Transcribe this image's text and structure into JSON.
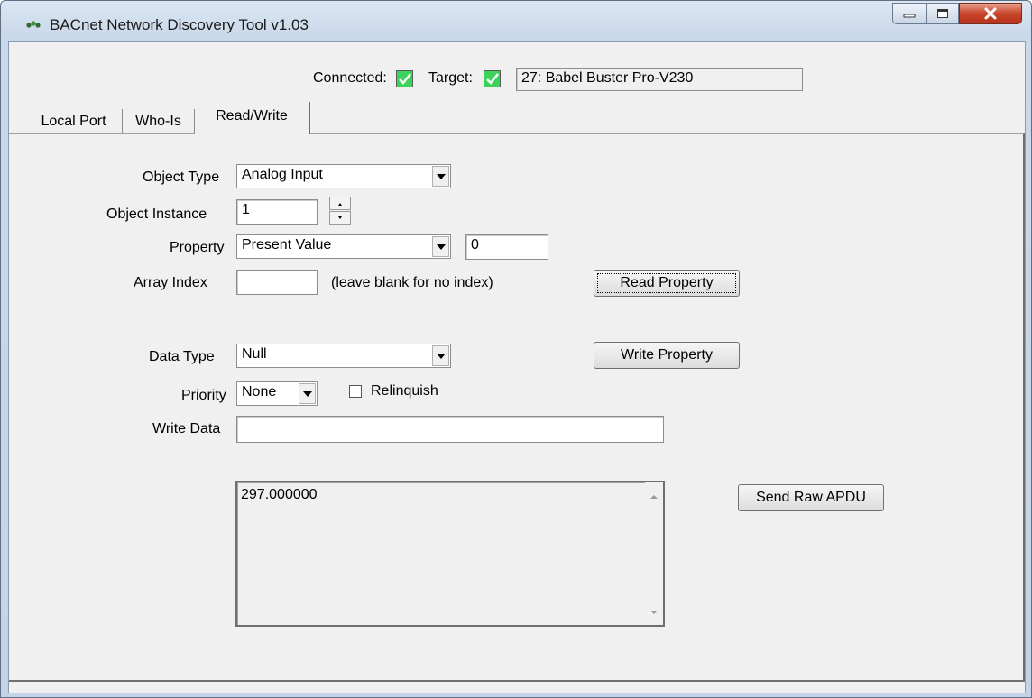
{
  "window": {
    "title": "BACnet Network Discovery Tool v1.03",
    "controls": {
      "minimize": "minimize",
      "maximize": "maximize",
      "close": "close"
    }
  },
  "status": {
    "connected_label": "Connected:",
    "connected_checked": true,
    "target_label": "Target:",
    "target_checked": true,
    "target_value": "27: Babel Buster Pro-V230"
  },
  "tabs": [
    {
      "label": "Local Port",
      "active": false
    },
    {
      "label": "Who-Is",
      "active": false
    },
    {
      "label": "Read/Write",
      "active": true
    }
  ],
  "read_write": {
    "object_type_label": "Object Type",
    "object_type_value": "Analog Input",
    "object_instance_label": "Object Instance",
    "object_instance_value": "1",
    "property_label": "Property",
    "property_value": "Present Value",
    "property_id_value": "0",
    "array_index_label": "Array Index",
    "array_index_value": "",
    "array_index_hint": "(leave blank for no index)",
    "read_button": "Read Property",
    "data_type_label": "Data Type",
    "data_type_value": "Null",
    "write_button": "Write Property",
    "priority_label": "Priority",
    "priority_value": "None",
    "relinquish_label": "Relinquish",
    "relinquish_checked": false,
    "write_data_label": "Write Data",
    "write_data_value": "",
    "output_text": "297.000000",
    "raw_apdu_button": "Send Raw APDU"
  }
}
